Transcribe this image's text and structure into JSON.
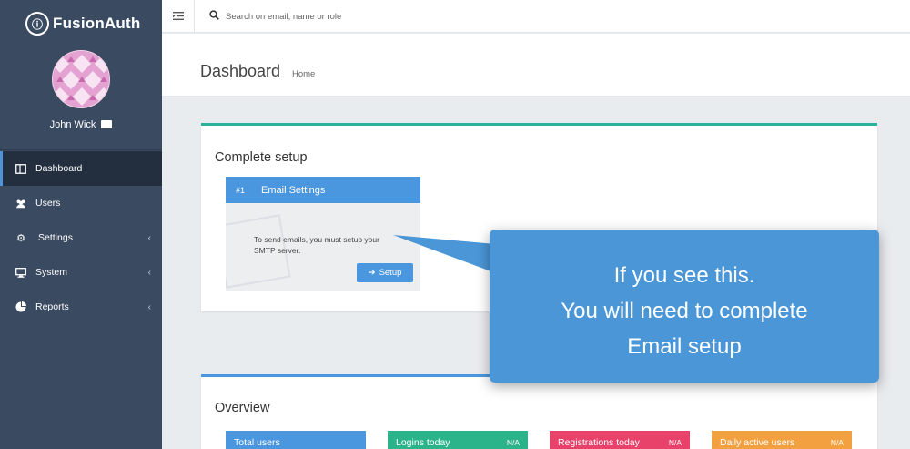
{
  "brand": {
    "name": "FusionAuth",
    "logo_icon": "fusionauth-logo-icon"
  },
  "user": {
    "name": "John Wick",
    "card_icon": "id-card-icon"
  },
  "sidebar": {
    "items": [
      {
        "label": "Dashboard",
        "icon": "dashboard-icon",
        "active": true,
        "has_submenu": false
      },
      {
        "label": "Users",
        "icon": "users-icon",
        "active": false,
        "has_submenu": false
      },
      {
        "label": "Settings",
        "icon": "gear-icon",
        "active": false,
        "has_submenu": true
      },
      {
        "label": "System",
        "icon": "monitor-icon",
        "active": false,
        "has_submenu": true
      },
      {
        "label": "Reports",
        "icon": "pie-chart-icon",
        "active": false,
        "has_submenu": true
      }
    ],
    "caret": "‹"
  },
  "topbar": {
    "search_placeholder": "Search on email, name or role"
  },
  "header": {
    "title": "Dashboard",
    "breadcrumb": "Home"
  },
  "setup": {
    "title": "Complete setup",
    "card": {
      "number": "#1",
      "title": "Email Settings",
      "text": "To send emails, you must setup your SMTP server.",
      "button_label": "Setup"
    }
  },
  "overview": {
    "title": "Overview",
    "stats": [
      {
        "label": "Total users",
        "value": "",
        "color": "#4a96df"
      },
      {
        "label": "Logins today",
        "value": "N/A",
        "color": "#2bb38a"
      },
      {
        "label": "Registrations today",
        "value": "N/A",
        "color": "#e8426a"
      },
      {
        "label": "Daily active users",
        "value": "N/A",
        "color": "#f3a140"
      }
    ]
  },
  "callout": {
    "line1": "If you see this.",
    "line2": "You will need to complete",
    "line3": "Email setup"
  },
  "colors": {
    "sidebar_bg": "#3a4a60",
    "accent_blue": "#4a96df",
    "accent_teal": "#2bb39a"
  }
}
